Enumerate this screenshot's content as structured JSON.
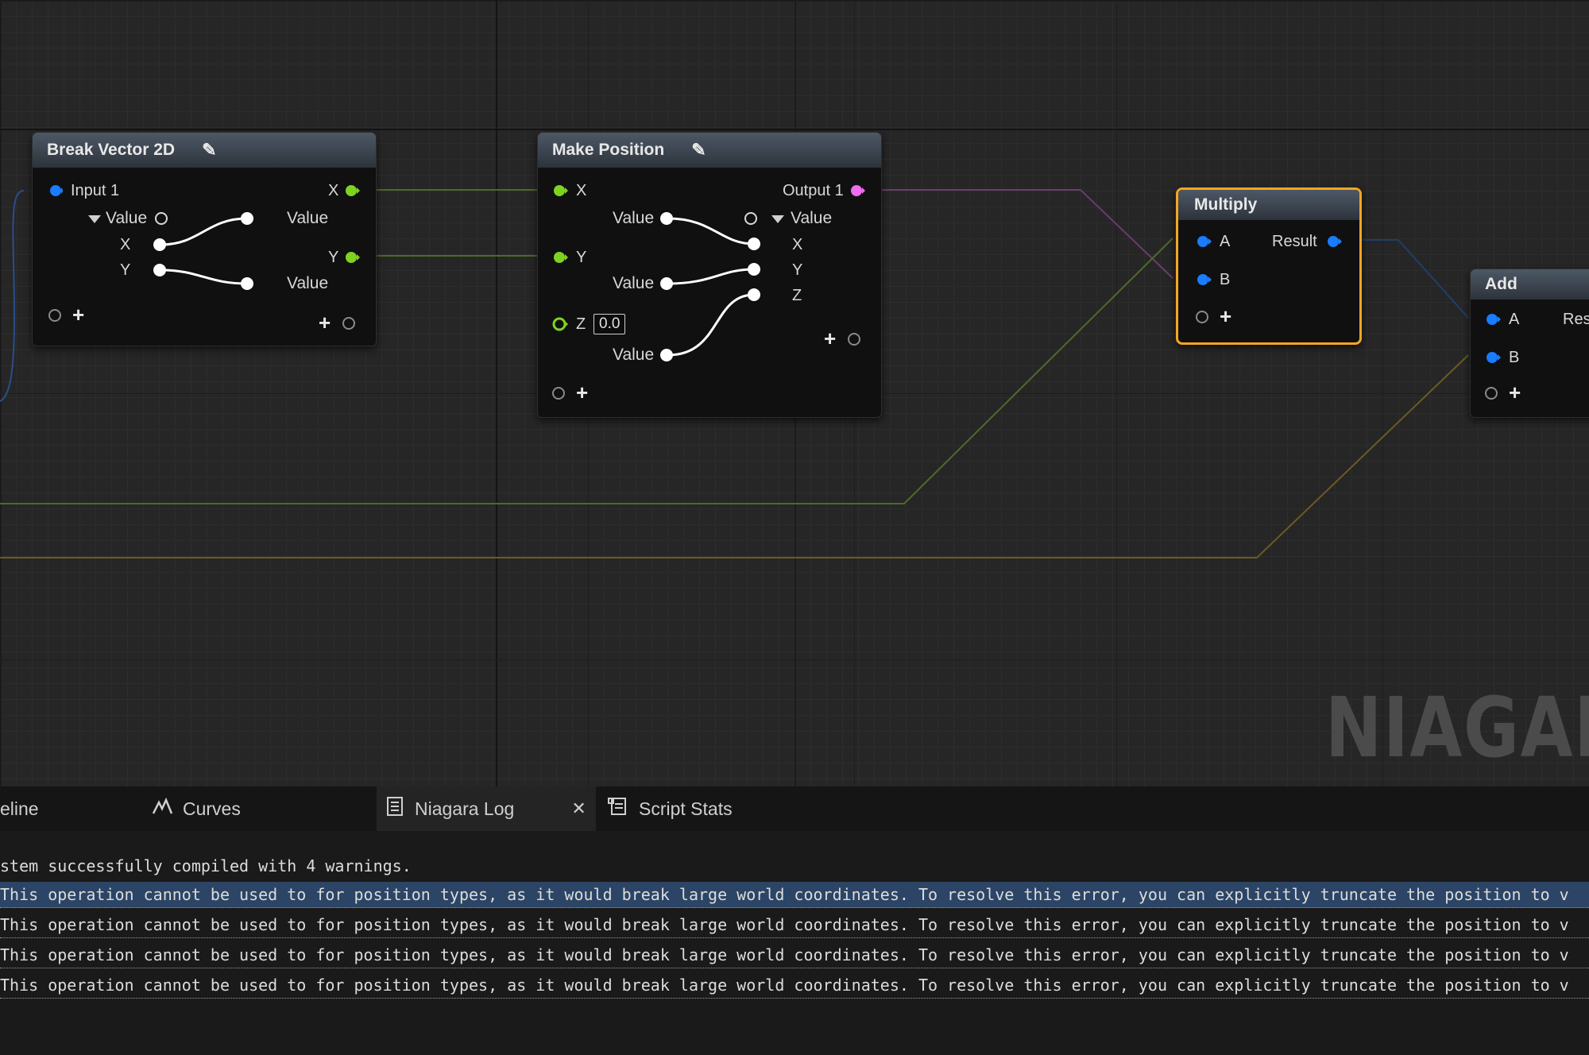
{
  "nodes": {
    "break_vector": {
      "title": "Break Vector 2D",
      "input_label": "Input 1",
      "value_in": "Value",
      "x": "X",
      "y": "Y",
      "out_x": "X",
      "out_y": "Y",
      "value_out_1": "Value",
      "value_out_2": "Value"
    },
    "make_position": {
      "title": "Make Position",
      "in_x": "X",
      "in_y": "Y",
      "in_z": "Z",
      "z_default": "0.0",
      "output_label": "Output 1",
      "value_1": "Value",
      "value_2": "Value",
      "value_3": "Value",
      "value_out": "Value",
      "ox": "X",
      "oy": "Y",
      "oz": "Z"
    },
    "multiply": {
      "title": "Multiply",
      "a": "A",
      "b": "B",
      "result": "Result"
    },
    "add": {
      "title": "Add",
      "a": "A",
      "b": "B",
      "result": "Res"
    }
  },
  "watermark": "NIAGAR",
  "tabs": [
    {
      "label": "eline",
      "icon": "timeline-icon"
    },
    {
      "label": "Curves",
      "icon": "curves-icon"
    },
    {
      "label": "Niagara Log",
      "icon": "log-icon",
      "active": true,
      "closable": true
    },
    {
      "label": "Script Stats",
      "icon": "script-stats-icon"
    }
  ],
  "log": {
    "header": "stem successfully compiled with 4 warnings.",
    "warnings": [
      "This operation cannot be used to for position types, as it would break large world coordinates. To resolve this error, you can explicitly truncate the position to v",
      "This operation cannot be used to for position types, as it would break large world coordinates. To resolve this error, you can explicitly truncate the position to v",
      "This operation cannot be used to for position types, as it would break large world coordinates. To resolve this error, you can explicitly truncate the position to v",
      "This operation cannot be used to for position types, as it would break large world coordinates. To resolve this error, you can explicitly truncate the position to v"
    ]
  },
  "colors": {
    "vector2_pin": "#7ed321",
    "float_pin": "#1a7cff",
    "position_pin": "#f06cf0",
    "selection_outline": "#f5a623"
  }
}
